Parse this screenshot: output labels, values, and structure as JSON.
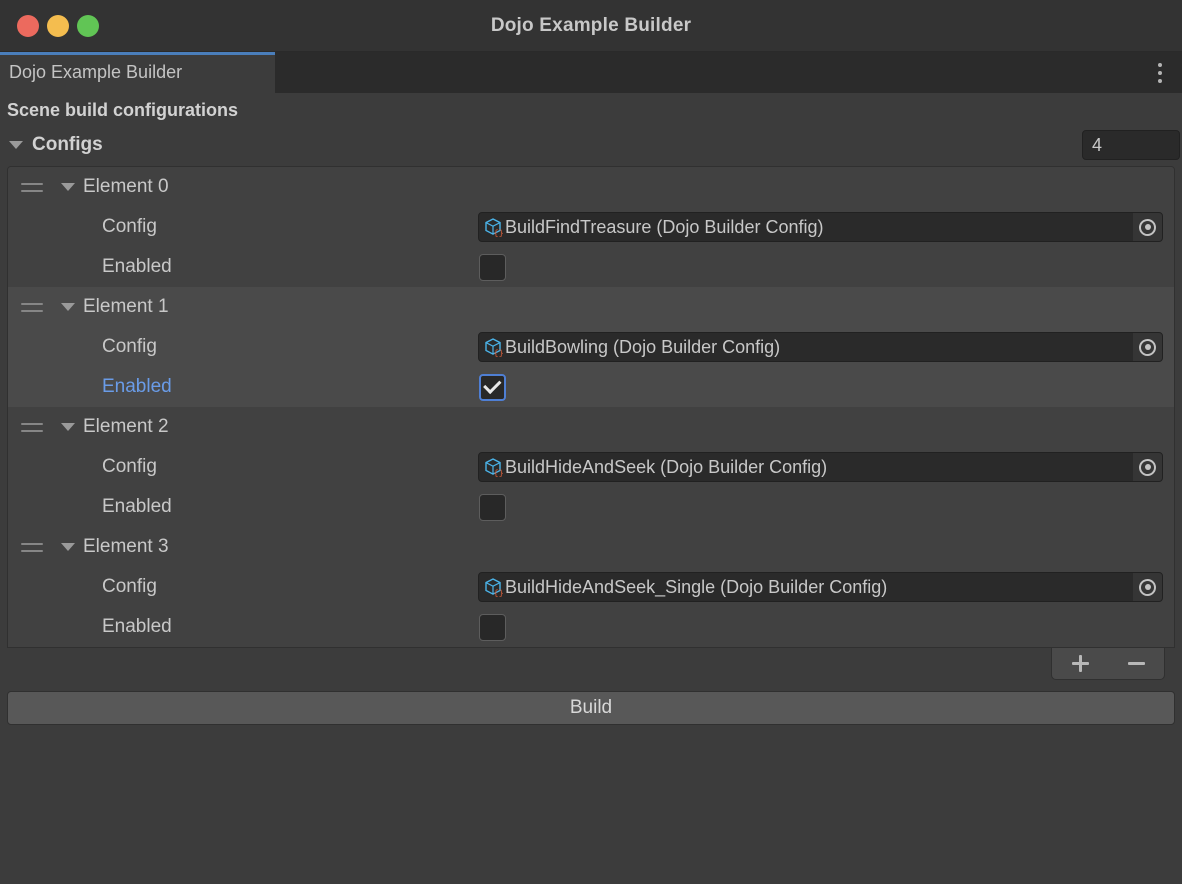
{
  "window": {
    "title": "Dojo Example Builder",
    "traffic_lights": [
      {
        "name": "close",
        "color": "#ec6a5e"
      },
      {
        "name": "minimize",
        "color": "#f4bd4f"
      },
      {
        "name": "maximize",
        "color": "#61c555"
      }
    ]
  },
  "tabbar": {
    "tab_label": "Dojo Example Builder",
    "menu_icon": "kebab-menu-icon",
    "active_accent": "#4a7ebb"
  },
  "main": {
    "section_title": "Scene build configurations",
    "configs": {
      "label": "Configs",
      "expanded": true,
      "size": "4",
      "property_labels": {
        "config": "Config",
        "enabled": "Enabled"
      },
      "elements": [
        {
          "label": "Element 0",
          "expanded": true,
          "config_value": "BuildFindTreasure (Dojo Builder Config)",
          "config_icon": "scriptable-object-icon",
          "enabled": false,
          "enabled_modified": false,
          "highlighted": false
        },
        {
          "label": "Element 1",
          "expanded": true,
          "config_value": "BuildBowling (Dojo Builder Config)",
          "config_icon": "scriptable-object-icon",
          "enabled": true,
          "enabled_modified": true,
          "highlighted": true
        },
        {
          "label": "Element 2",
          "expanded": true,
          "config_value": "BuildHideAndSeek (Dojo Builder Config)",
          "config_icon": "scriptable-object-icon",
          "enabled": false,
          "enabled_modified": false,
          "highlighted": false
        },
        {
          "label": "Element 3",
          "expanded": true,
          "config_value": "BuildHideAndSeek_Single (Dojo Builder Config)",
          "config_icon": "scriptable-object-icon",
          "enabled": false,
          "enabled_modified": false,
          "highlighted": false
        }
      ],
      "add_button": "+",
      "remove_button": "−"
    },
    "build_button": "Build"
  },
  "colors": {
    "window_bg": "#3c3c3c",
    "titlebar_bg": "#333333",
    "tabbar_bg": "#2b2b2b",
    "row_bg": "#414141",
    "row_bg_alt": "#4a4a4a",
    "field_bg": "#2a2a2a",
    "modified_label": "#6a9ce8",
    "checkbox_accent": "#4f7fd4",
    "build_button_bg": "#585858"
  }
}
